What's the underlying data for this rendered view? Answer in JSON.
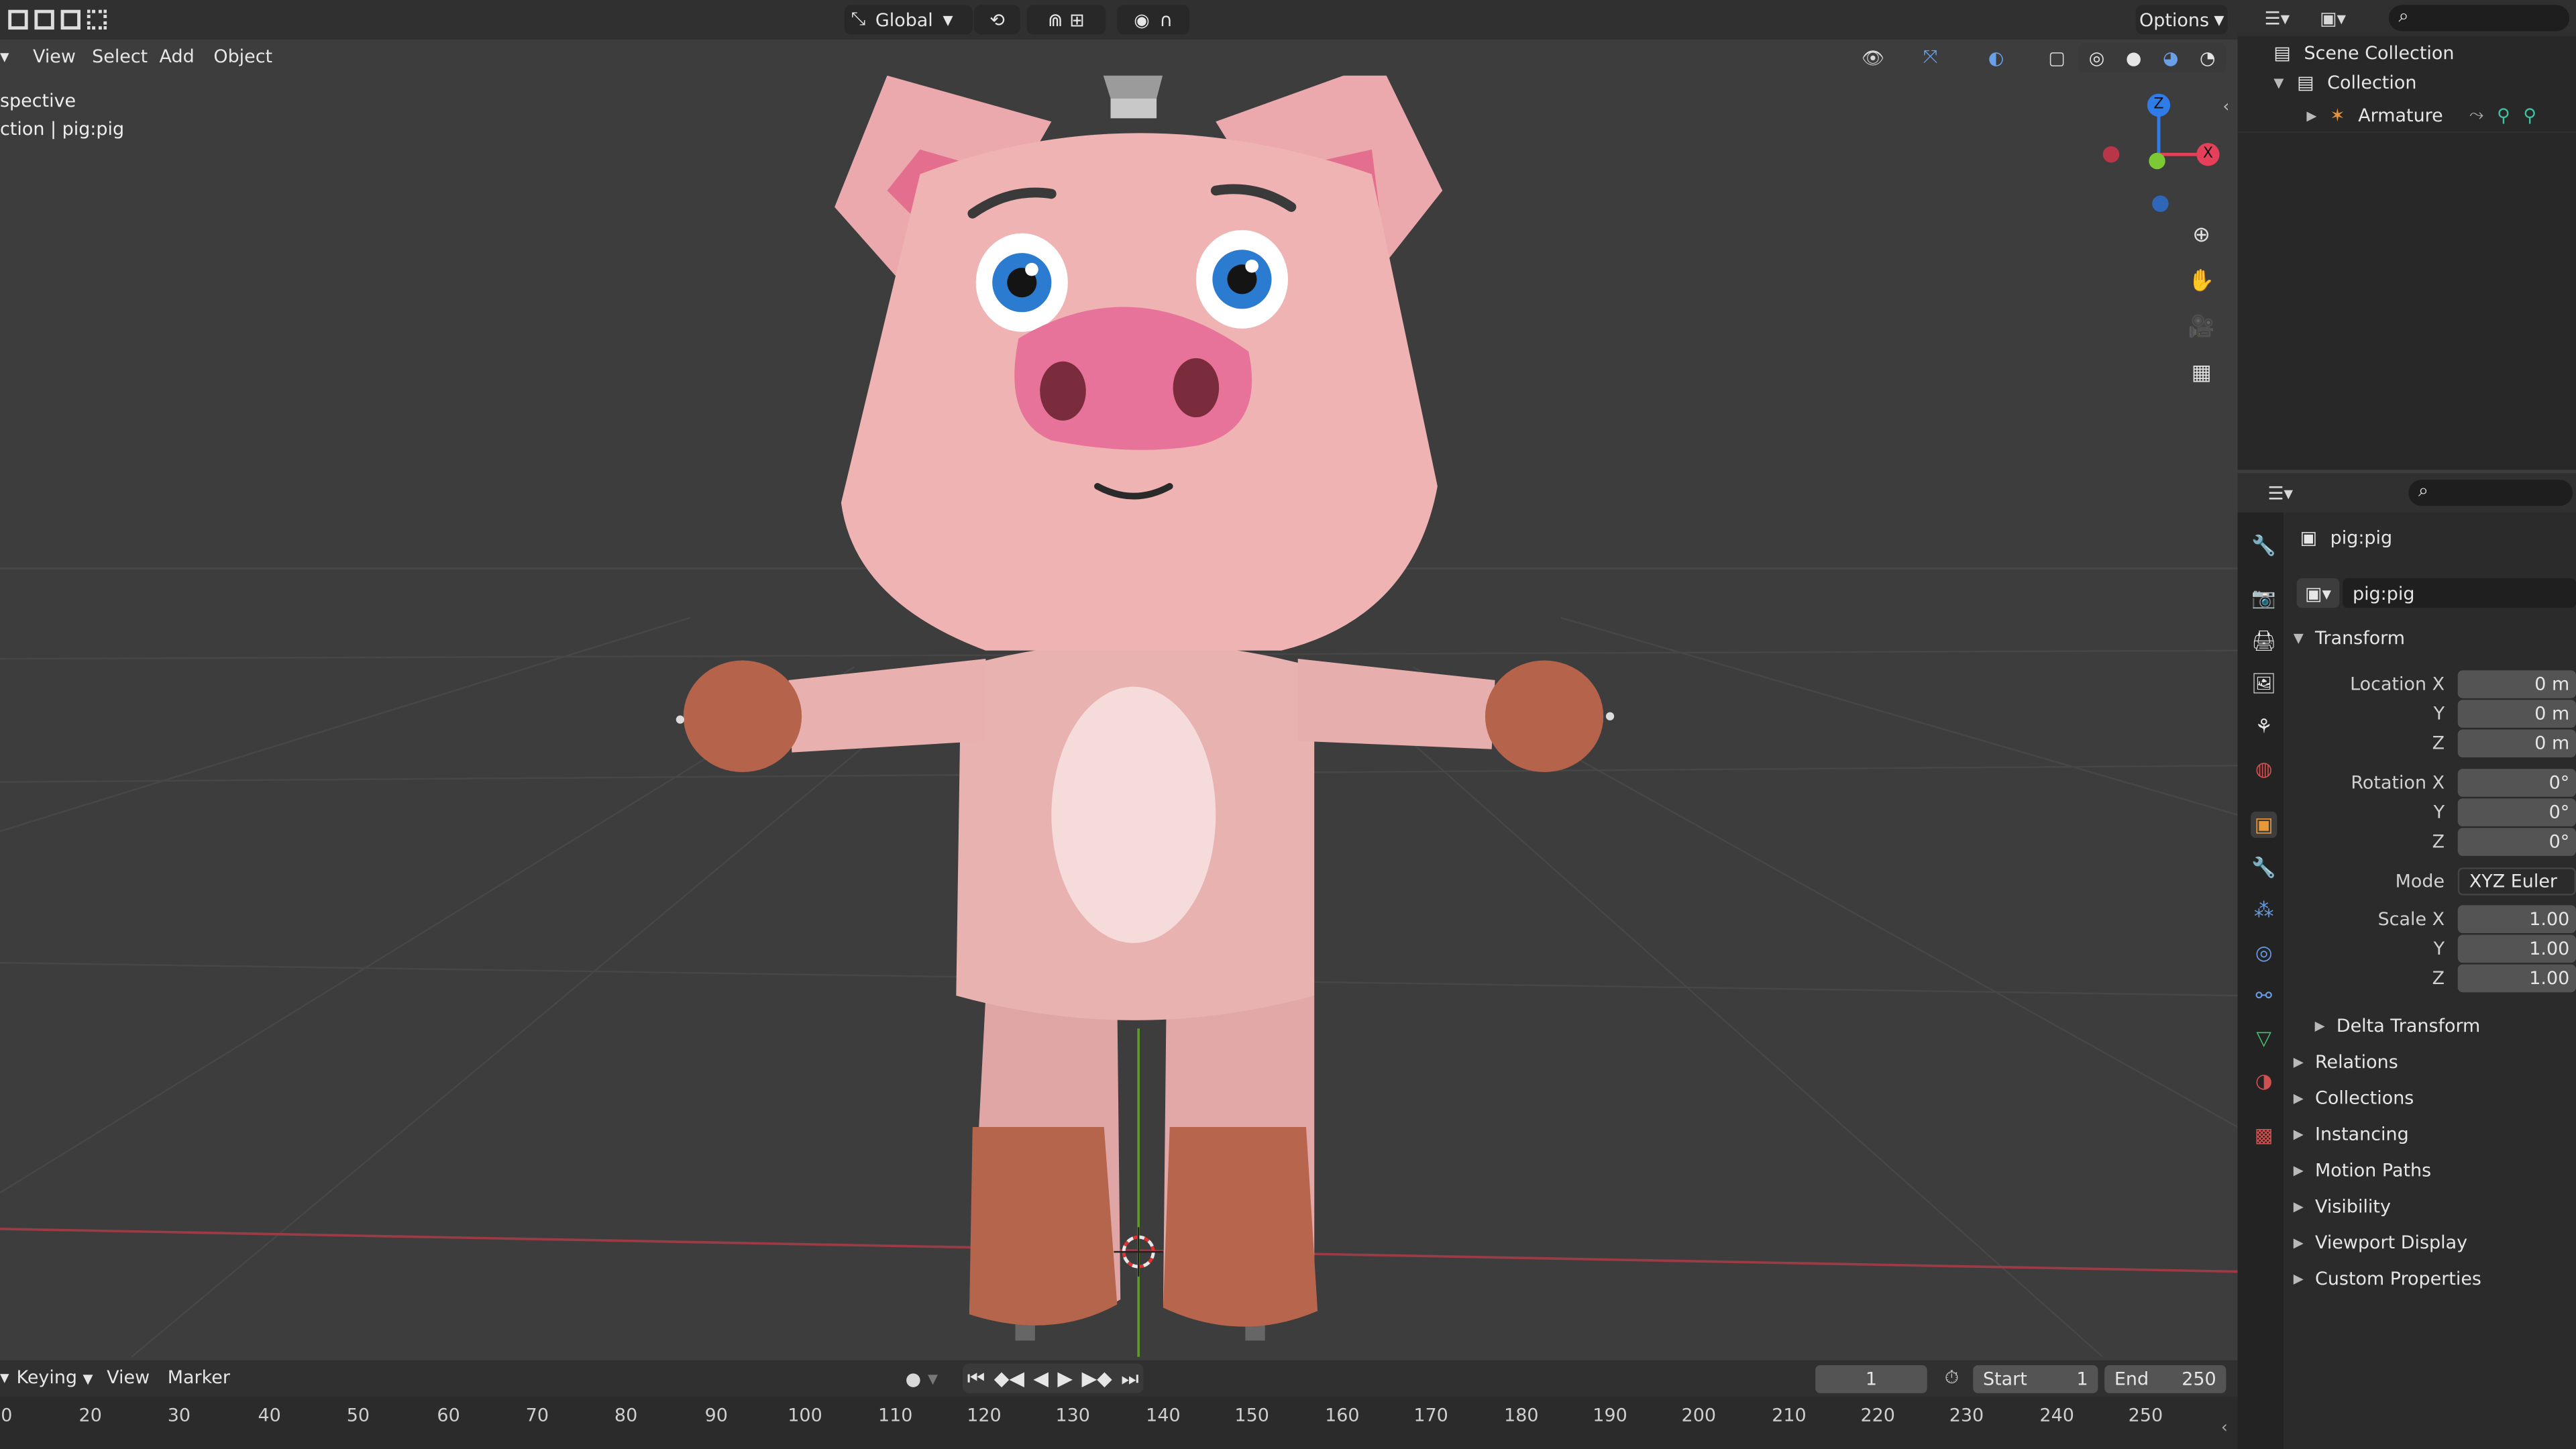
{
  "header": {
    "orientation": "Global",
    "options": "Options"
  },
  "menu": {
    "view": "View",
    "select": "Select",
    "add": "Add",
    "object": "Object"
  },
  "viewport": {
    "view_name": "spective",
    "collection_info": "ction | pig:pig"
  },
  "outliner": {
    "scene_collection": "Scene Collection",
    "collection": "Collection",
    "armature": "Armature"
  },
  "properties": {
    "object_name": "pig:pig",
    "data_name": "pig:pig",
    "transform_title": "Transform",
    "location_x_label": "Location X",
    "y_label": "Y",
    "z_label": "Z",
    "rotation_x_label": "Rotation X",
    "mode_label": "Mode",
    "scale_x_label": "Scale X",
    "location": [
      "0 m",
      "0 m",
      "0 m"
    ],
    "rotation": [
      "0°",
      "0°",
      "0°"
    ],
    "mode": "XYZ Euler",
    "scale": [
      "1.00",
      "1.00",
      "1.00"
    ],
    "delta_transform": "Delta Transform",
    "panels": [
      "Relations",
      "Collections",
      "Instancing",
      "Motion Paths",
      "Visibility",
      "Viewport Display",
      "Custom Properties"
    ]
  },
  "timeline": {
    "keying": "Keying",
    "view": "View",
    "marker": "Marker",
    "current_frame": "1",
    "start_label": "Start",
    "start": "1",
    "end_label": "End",
    "end": "250",
    "ticks": [
      "0",
      "20",
      "30",
      "40",
      "50",
      "60",
      "70",
      "80",
      "90",
      "100",
      "110",
      "120",
      "130",
      "140",
      "150",
      "160",
      "170",
      "180",
      "190",
      "200",
      "210",
      "220",
      "230",
      "240",
      "250"
    ]
  },
  "gizmo": {
    "z": "Z",
    "x": "X"
  },
  "colors": {
    "accent": "#4772b3",
    "x_axis": "#e53f5a",
    "y_axis": "#6ba32a",
    "z_axis": "#2f7ce8"
  }
}
